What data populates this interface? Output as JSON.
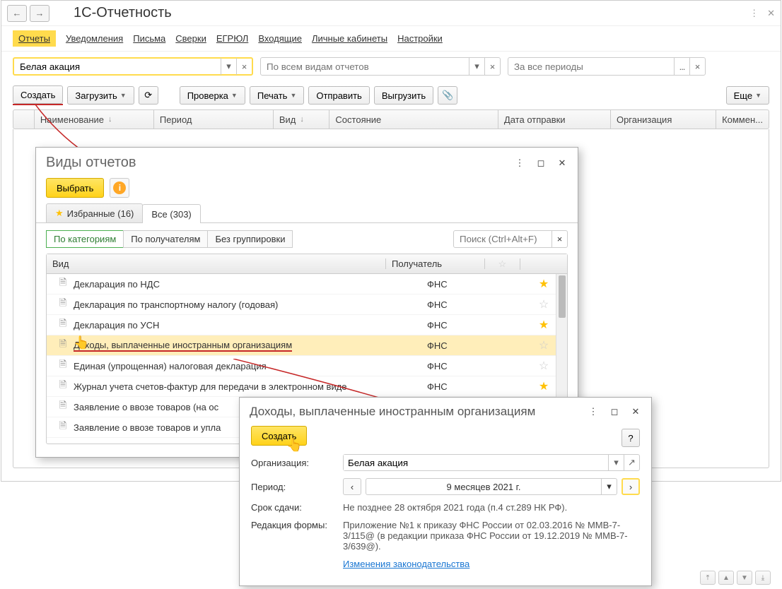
{
  "title": "1С-Отчетность",
  "menu": {
    "items": [
      "Отчеты",
      "Уведомления",
      "Письма",
      "Сверки",
      "ЕГРЮЛ",
      "Входящие",
      "Личные кабинеты",
      "Настройки"
    ],
    "activeIndex": 0
  },
  "filters": {
    "org_value": "Белая акация",
    "report_placeholder": "По всем видам отчетов",
    "period_placeholder": "За все периоды"
  },
  "toolbar": {
    "create": "Создать",
    "load": "Загрузить",
    "check": "Проверка",
    "print": "Печать",
    "send": "Отправить",
    "export": "Выгрузить",
    "more": "Еще"
  },
  "columns": {
    "name": "Наименование",
    "period": "Период",
    "vid": "Вид",
    "state": "Состояние",
    "sent": "Дата отправки",
    "org": "Организация",
    "comment": "Коммен..."
  },
  "dlg1": {
    "title": "Виды отчетов",
    "select": "Выбрать",
    "tab_fav": "Избранные (16)",
    "tab_all": "Все (303)",
    "ftab_cat": "По категориям",
    "ftab_recv": "По получателям",
    "ftab_none": "Без группировки",
    "search_placeholder": "Поиск (Ctrl+Alt+F)",
    "col_vid": "Вид",
    "col_recv": "Получатель",
    "rows": [
      {
        "vid": "Декларация по НДС",
        "recv": "ФНС",
        "star": true
      },
      {
        "vid": "Декларация по транспортному налогу (годовая)",
        "recv": "ФНС",
        "star": false
      },
      {
        "vid": "Декларация по УСН",
        "recv": "ФНС",
        "star": true
      },
      {
        "vid": "Доходы, выплаченные иностранным организациям",
        "recv": "ФНС",
        "star": false,
        "selected": true
      },
      {
        "vid": "Единая (упрощенная) налоговая декларация",
        "recv": "ФНС",
        "star": false
      },
      {
        "vid": "Журнал учета счетов-фактур для передачи в электронном виде",
        "recv": "ФНС",
        "star": true
      },
      {
        "vid": "Заявление о ввозе товаров (на ос",
        "recv": "",
        "star": false
      },
      {
        "vid": "Заявление о ввозе товаров и упла",
        "recv": "",
        "star": false
      }
    ]
  },
  "dlg2": {
    "title": "Доходы, выплаченные иностранным организациям",
    "create": "Создать",
    "org_label": "Организация:",
    "org_value": "Белая акация",
    "period_label": "Период:",
    "period_value": "9 месяцев 2021 г.",
    "deadline_label": "Срок сдачи:",
    "deadline_value": "Не позднее 28 октября 2021 года (п.4 ст.289 НК РФ).",
    "edition_label": "Редакция формы:",
    "edition_value": "Приложение №1 к приказу ФНС России от 02.03.2016 № ММВ-7-3/115@ (в редакции приказа ФНС России от 19.12.2019 № ММВ-7-3/639@).",
    "link": "Изменения законодательства",
    "help": "?"
  }
}
